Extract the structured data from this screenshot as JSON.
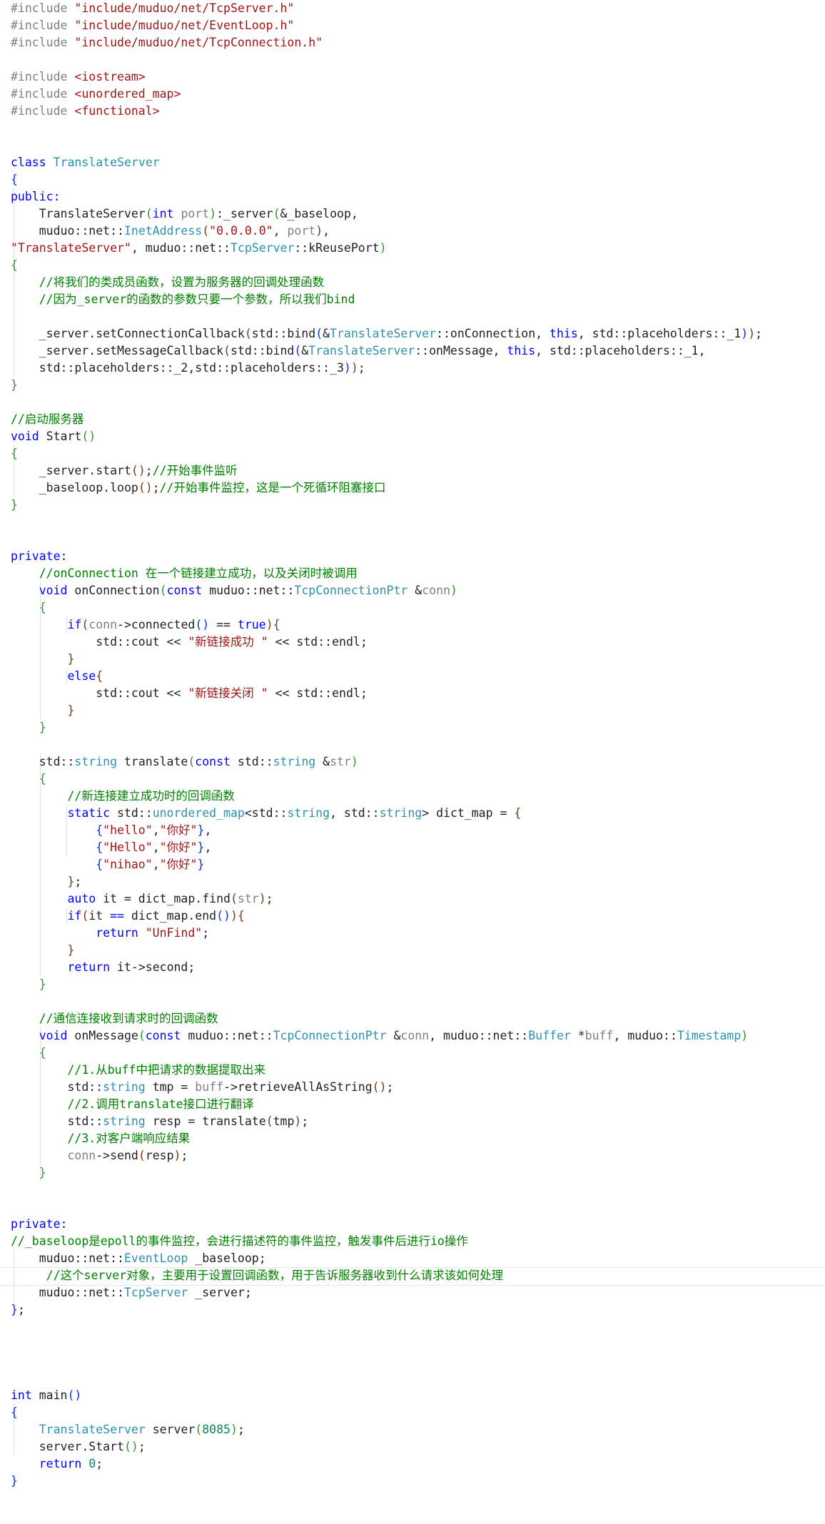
{
  "editor": {
    "colors": {
      "background": "#ffffff",
      "preprocessor": "#808080",
      "include_path": "#a31515",
      "keyword": "#0000ff",
      "type": "#2b91af",
      "string": "#a31515",
      "comment": "#008000",
      "parameter": "#808080",
      "number": "#098658",
      "bracket_level_1": "#0431fa",
      "bracket_level_2": "#319331",
      "bracket_level_3": "#7b3814",
      "text": "#1f1f1f"
    },
    "lines": [
      [
        [
          "pp",
          "#include "
        ],
        [
          "inc",
          "\"include/muduo/net/TcpServer.h\""
        ]
      ],
      [
        [
          "pp",
          "#include "
        ],
        [
          "inc",
          "\"include/muduo/net/EventLoop.h\""
        ]
      ],
      [
        [
          "pp",
          "#include "
        ],
        [
          "inc",
          "\"include/muduo/net/TcpConnection.h\""
        ]
      ],
      [],
      [
        [
          "pp",
          "#include "
        ],
        [
          "inc",
          "<iostream>"
        ]
      ],
      [
        [
          "pp",
          "#include "
        ],
        [
          "inc",
          "<unordered_map>"
        ]
      ],
      [
        [
          "pp",
          "#include "
        ],
        [
          "inc",
          "<functional>"
        ]
      ],
      [],
      [],
      [
        [
          "kw",
          "class "
        ],
        [
          "ty",
          "TranslateServer"
        ]
      ],
      [
        [
          "b1",
          "{"
        ]
      ],
      [
        [
          "kw",
          "public:"
        ]
      ],
      [
        [
          "id",
          "    TranslateServer"
        ],
        [
          "b2",
          "("
        ],
        [
          "kw",
          "int "
        ],
        [
          "pm",
          "port"
        ],
        [
          "b2",
          ")"
        ],
        [
          "id",
          ":_server"
        ],
        [
          "b2",
          "("
        ],
        [
          "id",
          "&_baseloop,"
        ]
      ],
      [
        [
          "id",
          "    muduo::net::"
        ],
        [
          "ty",
          "InetAddress"
        ],
        [
          "b3",
          "("
        ],
        [
          "st",
          "\"0.0.0.0\""
        ],
        [
          "id",
          ", "
        ],
        [
          "pm",
          "port"
        ],
        [
          "b3",
          ")"
        ],
        [
          "id",
          ","
        ]
      ],
      [
        [
          "st",
          "\"TranslateServer\""
        ],
        [
          "id",
          ", muduo::net::"
        ],
        [
          "ty",
          "TcpServer"
        ],
        [
          "id",
          "::kReusePort"
        ],
        [
          "b2",
          ")"
        ]
      ],
      [
        [
          "b2",
          "{"
        ]
      ],
      [
        [
          "cm",
          "    //将我们的类成员函数，设置为服务器的回调处理函数"
        ]
      ],
      [
        [
          "cm",
          "    //因为_server的函数的参数只要一个参数，所以我们bind"
        ]
      ],
      [],
      [
        [
          "id",
          "    _server.setConnectionCallback"
        ],
        [
          "b3",
          "("
        ],
        [
          "id",
          "std::bind"
        ],
        [
          "b1",
          "("
        ],
        [
          "id",
          "&"
        ],
        [
          "ty",
          "TranslateServer"
        ],
        [
          "id",
          "::onConnection, "
        ],
        [
          "kw",
          "this"
        ],
        [
          "id",
          ", std::placeholders::_1"
        ],
        [
          "b1",
          ")"
        ],
        [
          "b3",
          ")"
        ],
        [
          "id",
          ";"
        ]
      ],
      [
        [
          "id",
          "    _server.setMessageCallback"
        ],
        [
          "b3",
          "("
        ],
        [
          "id",
          "std::bind"
        ],
        [
          "b1",
          "("
        ],
        [
          "id",
          "&"
        ],
        [
          "ty",
          "TranslateServer"
        ],
        [
          "id",
          "::onMessage, "
        ],
        [
          "kw",
          "this"
        ],
        [
          "id",
          ", std::placeholders::_1,"
        ]
      ],
      [
        [
          "id",
          "    std::placeholders::_2,std::placeholders::_3"
        ],
        [
          "b1",
          ")"
        ],
        [
          "b3",
          ")"
        ],
        [
          "id",
          ";"
        ]
      ],
      [
        [
          "b2",
          "}"
        ]
      ],
      [],
      [
        [
          "cm",
          "//启动服务器"
        ]
      ],
      [
        [
          "kw",
          "void "
        ],
        [
          "id",
          "Start"
        ],
        [
          "b2",
          "()"
        ]
      ],
      [
        [
          "b2",
          "{"
        ]
      ],
      [
        [
          "id",
          "    _server.start"
        ],
        [
          "b3",
          "()"
        ],
        [
          "id",
          ";"
        ],
        [
          "cm",
          "//开始事件监听"
        ]
      ],
      [
        [
          "id",
          "    _baseloop.loop"
        ],
        [
          "b3",
          "()"
        ],
        [
          "id",
          ";"
        ],
        [
          "cm",
          "//开始事件监控，这是一个死循环阻塞接口"
        ]
      ],
      [
        [
          "b2",
          "}"
        ]
      ],
      [],
      [],
      [
        [
          "kw",
          "private:"
        ]
      ],
      [
        [
          "cm",
          "    //onConnection 在一个链接建立成功，以及关闭时被调用"
        ]
      ],
      [
        [
          "kw",
          "    void "
        ],
        [
          "id",
          "onConnection"
        ],
        [
          "b2",
          "("
        ],
        [
          "kw",
          "const "
        ],
        [
          "id",
          "muduo::net::"
        ],
        [
          "ty",
          "TcpConnectionPtr "
        ],
        [
          "pu",
          "&"
        ],
        [
          "pm",
          "conn"
        ],
        [
          "b2",
          ")"
        ]
      ],
      [
        [
          "b2",
          "    {"
        ]
      ],
      [
        [
          "kw",
          "        if"
        ],
        [
          "b3",
          "("
        ],
        [
          "pm",
          "conn"
        ],
        [
          "pu",
          "->"
        ],
        [
          "id",
          "connected"
        ],
        [
          "b1",
          "()"
        ],
        [
          "id",
          " == "
        ],
        [
          "kw",
          "true"
        ],
        [
          "b3",
          ")"
        ],
        [
          "b3",
          "{"
        ]
      ],
      [
        [
          "id",
          "            std::cout "
        ],
        [
          "pu",
          "<<"
        ],
        [
          "st",
          " \"新链接成功 \""
        ],
        [
          "pu",
          " <<"
        ],
        [
          "id",
          " std::endl;"
        ]
      ],
      [
        [
          "b3",
          "        }"
        ]
      ],
      [
        [
          "kw",
          "        else"
        ],
        [
          "b3",
          "{"
        ]
      ],
      [
        [
          "id",
          "            std::cout "
        ],
        [
          "pu",
          "<<"
        ],
        [
          "st",
          " \"新链接关闭 \""
        ],
        [
          "pu",
          " <<"
        ],
        [
          "id",
          " std::endl;"
        ]
      ],
      [
        [
          "b3",
          "        }"
        ]
      ],
      [
        [
          "b2",
          "    }"
        ]
      ],
      [],
      [
        [
          "id",
          "    std::"
        ],
        [
          "ty",
          "string "
        ],
        [
          "id",
          "translate"
        ],
        [
          "b2",
          "("
        ],
        [
          "kw",
          "const "
        ],
        [
          "id",
          "std::"
        ],
        [
          "ty",
          "string "
        ],
        [
          "pu",
          "&"
        ],
        [
          "pm",
          "str"
        ],
        [
          "b2",
          ")"
        ]
      ],
      [
        [
          "b2",
          "    {"
        ]
      ],
      [
        [
          "cm",
          "        //新连接建立成功时的回调函数"
        ]
      ],
      [
        [
          "kw",
          "        static "
        ],
        [
          "id",
          "std::"
        ],
        [
          "ty",
          "unordered_map"
        ],
        [
          "id",
          "<std::"
        ],
        [
          "ty",
          "string"
        ],
        [
          "id",
          ", std::"
        ],
        [
          "ty",
          "string"
        ],
        [
          "id",
          "> dict_map = "
        ],
        [
          "b3",
          "{"
        ]
      ],
      [
        [
          "b1",
          "            {"
        ],
        [
          "st",
          "\"hello\""
        ],
        [
          "id",
          ","
        ],
        [
          "st",
          "\"你好\""
        ],
        [
          "b1",
          "}"
        ],
        [
          "id",
          ","
        ]
      ],
      [
        [
          "b1",
          "            {"
        ],
        [
          "st",
          "\"Hello\""
        ],
        [
          "id",
          ","
        ],
        [
          "st",
          "\"你好\""
        ],
        [
          "b1",
          "}"
        ],
        [
          "id",
          ","
        ]
      ],
      [
        [
          "b1",
          "            {"
        ],
        [
          "st",
          "\"nihao\""
        ],
        [
          "id",
          ","
        ],
        [
          "st",
          "\"你好\""
        ],
        [
          "b1",
          "}"
        ]
      ],
      [
        [
          "b3",
          "        }"
        ],
        [
          "id",
          ";"
        ]
      ],
      [
        [
          "kw",
          "        auto "
        ],
        [
          "id",
          "it = dict_map.find"
        ],
        [
          "b3",
          "("
        ],
        [
          "pm",
          "str"
        ],
        [
          "b3",
          ")"
        ],
        [
          "id",
          ";"
        ]
      ],
      [
        [
          "kw",
          "        if"
        ],
        [
          "b3",
          "("
        ],
        [
          "id",
          "it "
        ],
        [
          "kw",
          "=="
        ],
        [
          "id",
          " dict_map.end"
        ],
        [
          "b1",
          "()"
        ],
        [
          "b3",
          ")"
        ],
        [
          "b3",
          "{"
        ]
      ],
      [
        [
          "kw",
          "            return "
        ],
        [
          "st",
          "\"UnFind\""
        ],
        [
          "id",
          ";"
        ]
      ],
      [
        [
          "b3",
          "        }"
        ]
      ],
      [
        [
          "kw",
          "        return "
        ],
        [
          "id",
          "it"
        ],
        [
          "pu",
          "->"
        ],
        [
          "id",
          "second;"
        ]
      ],
      [
        [
          "b2",
          "    }"
        ]
      ],
      [],
      [
        [
          "cm",
          "    //通信连接收到请求时的回调函数"
        ]
      ],
      [
        [
          "kw",
          "    void "
        ],
        [
          "id",
          "onMessage"
        ],
        [
          "b2",
          "("
        ],
        [
          "kw",
          "const "
        ],
        [
          "id",
          "muduo::net::"
        ],
        [
          "ty",
          "TcpConnectionPtr "
        ],
        [
          "pu",
          "&"
        ],
        [
          "pm",
          "conn"
        ],
        [
          "id",
          ", muduo::net::"
        ],
        [
          "ty",
          "Buffer "
        ],
        [
          "pu",
          "*"
        ],
        [
          "pm",
          "buff"
        ],
        [
          "id",
          ", muduo::"
        ],
        [
          "ty",
          "Timestamp"
        ],
        [
          "b2",
          ")"
        ]
      ],
      [
        [
          "b2",
          "    {"
        ]
      ],
      [
        [
          "cm",
          "        //1.从buff中把请求的数据提取出来"
        ]
      ],
      [
        [
          "id",
          "        std::"
        ],
        [
          "ty",
          "string "
        ],
        [
          "id",
          "tmp = "
        ],
        [
          "pm",
          "buff"
        ],
        [
          "pu",
          "->"
        ],
        [
          "id",
          "retrieveAllAsString"
        ],
        [
          "b3",
          "()"
        ],
        [
          "id",
          ";"
        ]
      ],
      [
        [
          "cm",
          "        //2.调用translate接口进行翻译"
        ]
      ],
      [
        [
          "id",
          "        std::"
        ],
        [
          "ty",
          "string "
        ],
        [
          "id",
          "resp = translate"
        ],
        [
          "b3",
          "("
        ],
        [
          "id",
          "tmp"
        ],
        [
          "b3",
          ")"
        ],
        [
          "id",
          ";"
        ]
      ],
      [
        [
          "cm",
          "        //3.对客户端响应结果"
        ]
      ],
      [
        [
          "pm",
          "        conn"
        ],
        [
          "pu",
          "->"
        ],
        [
          "id",
          "send"
        ],
        [
          "b3",
          "("
        ],
        [
          "id",
          "resp"
        ],
        [
          "b3",
          ")"
        ],
        [
          "id",
          ";"
        ]
      ],
      [
        [
          "b2",
          "    }"
        ]
      ],
      [],
      [],
      [
        [
          "kw",
          "private:"
        ]
      ],
      [
        [
          "cm",
          "//_baseloop是epoll的事件监控，会进行描述符的事件监控，触发事件后进行io操作"
        ]
      ],
      [
        [
          "id",
          "    muduo::net::"
        ],
        [
          "ty",
          "EventLoop "
        ],
        [
          "id",
          "_baseloop;"
        ]
      ],
      [
        [
          "cm",
          "     //这个server对象，主要用于设置回调函数，用于告诉服务器收到什么请求该如何处理"
        ]
      ],
      [
        [
          "id",
          "    muduo::net::"
        ],
        [
          "ty",
          "TcpServer "
        ],
        [
          "id",
          "_server;"
        ]
      ],
      [
        [
          "b1",
          "}"
        ],
        [
          "id",
          ";"
        ]
      ],
      [],
      [],
      [],
      [],
      [
        [
          "kw",
          "int "
        ],
        [
          "id",
          "main"
        ],
        [
          "b1",
          "()"
        ]
      ],
      [
        [
          "b1",
          "{"
        ]
      ],
      [
        [
          "ty",
          "    TranslateServer "
        ],
        [
          "id",
          "server"
        ],
        [
          "b2",
          "("
        ],
        [
          "num",
          "8085"
        ],
        [
          "b2",
          ")"
        ],
        [
          "id",
          ";"
        ]
      ],
      [
        [
          "id",
          "    server.Start"
        ],
        [
          "b2",
          "()"
        ],
        [
          "id",
          ";"
        ]
      ],
      [
        [
          "kw",
          "    return "
        ],
        [
          "num",
          "0"
        ],
        [
          "id",
          ";"
        ]
      ],
      [
        [
          "b1",
          "}"
        ]
      ]
    ]
  }
}
